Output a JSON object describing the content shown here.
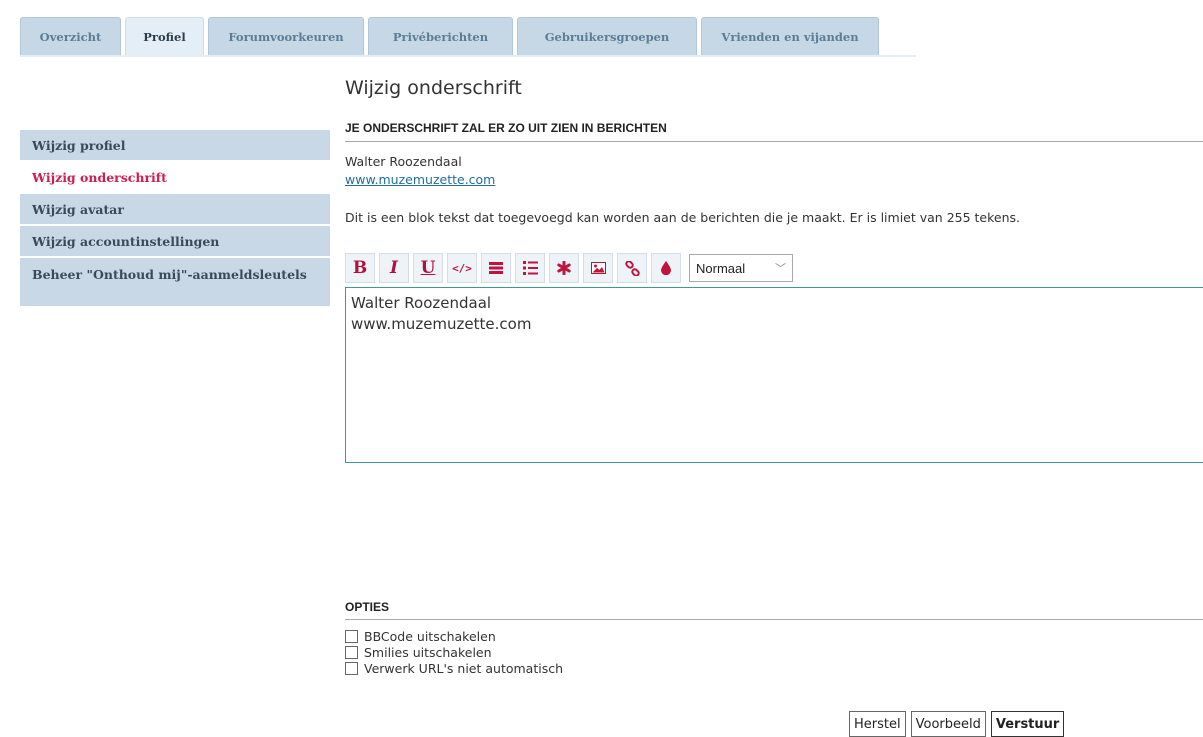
{
  "tabs": [
    {
      "label": "Overzicht"
    },
    {
      "label": "Profiel",
      "active": true
    },
    {
      "label": "Forumvoorkeuren"
    },
    {
      "label": "Privéberichten"
    },
    {
      "label": "Gebruikersgroepen"
    },
    {
      "label": "Vrienden en vijanden"
    }
  ],
  "sidebar": {
    "items": [
      {
        "label": "Wijzig profiel"
      },
      {
        "label": "Wijzig onderschrift",
        "active": true
      },
      {
        "label": "Wijzig avatar"
      },
      {
        "label": "Wijzig accountinstellingen"
      },
      {
        "label": "Beheer \"Onthoud mij\"-aanmeldsleutels"
      }
    ]
  },
  "main": {
    "title": "Wijzig onderschrift",
    "preview_heading": "JE ONDERSCHRIFT ZAL ER ZO UIT ZIEN IN BERICHTEN",
    "preview_name": "Walter Roozendaal",
    "preview_link": "www.muzemuzette.com",
    "explanation": "Dit is een blok tekst dat toegevoegd kan worden aan de berichten die je maakt. Er is limiet van 255 tekens.",
    "toolbar": {
      "bold": "B",
      "italic": "I",
      "underline": "U",
      "code": "</>",
      "font_size_value": "Normaal"
    },
    "editor_text": "Walter Roozendaal\nwww.muzemuzette.com"
  },
  "options": {
    "heading": "OPTIES",
    "items": [
      {
        "label": "BBCode uitschakelen"
      },
      {
        "label": "Smilies uitschakelen"
      },
      {
        "label": "Verwerk URL's niet automatisch"
      }
    ]
  },
  "buttons": {
    "reset": "Herstel",
    "preview": "Voorbeeld",
    "submit": "Verstuur"
  },
  "colors": {
    "accent": "#cf1d4d",
    "tab_bg": "#c6d7e5",
    "link": "#1f6e9f",
    "editor_border": "#3a9a9a"
  }
}
